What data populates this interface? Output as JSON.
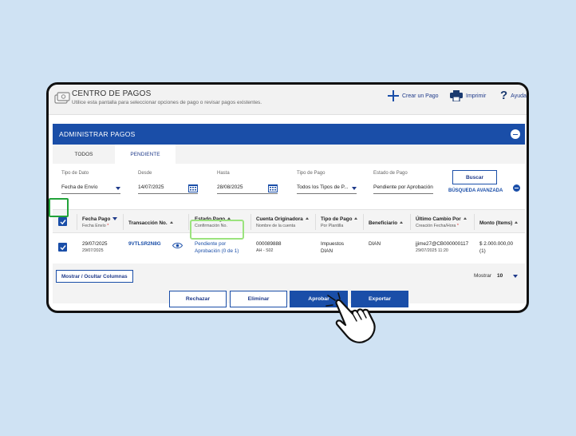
{
  "app": {
    "title": "CENTRO DE PAGOS",
    "subtitle": "Utilice esta pantalla para seleccionar opciones de pago o revisar pagos existentes.",
    "icon": "payment-cards-icon"
  },
  "top_actions": {
    "create": {
      "label": "Crear un Pago",
      "icon": "plus-icon"
    },
    "print": {
      "label": "Imprimir",
      "icon": "printer-icon"
    },
    "help": {
      "label": "Ayuda",
      "icon": "question-icon"
    }
  },
  "panel": {
    "title": "ADMINISTRAR PAGOS",
    "tabs": [
      {
        "label": "TODOS",
        "active": false
      },
      {
        "label": "PENDIENTE",
        "active": true
      }
    ]
  },
  "filters": {
    "date_type": {
      "label": "Tipo de Dato",
      "value": "Fecha de Envío"
    },
    "from": {
      "label": "Desde",
      "value": "14/07/2025"
    },
    "to": {
      "label": "Hasta",
      "value": "28/08/2025"
    },
    "payment_type": {
      "label": "Tipo de Pago",
      "value": "Todos los Tipos de P..."
    },
    "payment_status": {
      "label": "Estado de Pago",
      "value": "Pendiente por Aprobación"
    },
    "search_button": "Buscar",
    "advanced_search": "BÚSQUEDA AVANZADA"
  },
  "table": {
    "columns": [
      {
        "title": "Fecha Pago",
        "sub": "Fecha Envío",
        "sub_required": true
      },
      {
        "title": "Transacción No.",
        "sub": ""
      },
      {
        "title": "Estado Pago",
        "sub": "Confirmación No."
      },
      {
        "title": "Cuenta Originadora",
        "sub": "Nombre de la cuenta"
      },
      {
        "title": "Tipo de Pago",
        "sub": "Por Plantilla"
      },
      {
        "title": "Beneficiario",
        "sub": ""
      },
      {
        "title": "Último Cambio Por",
        "sub": "Creación Fecha/Hora",
        "sub_required": true
      },
      {
        "title": "Monto (Items)",
        "sub": ""
      }
    ],
    "rows": [
      {
        "selected": true,
        "fecha_pago": "29/07/2025",
        "fecha_envio": "29/07/2025",
        "transaccion": "9VTLSR2N8G",
        "estado_line1": "Pendiente por",
        "estado_line2": "Aprobación (0 de 1)",
        "cuenta": "000089888",
        "cuenta_nombre": "AH - S02",
        "tipo_line1": "Impuestos",
        "tipo_line2": "DIAN",
        "beneficiario": "DIAN",
        "ultimo_cambio": "jjime27@CB000000117",
        "creacion": "29/07/2025 11:20",
        "monto": "$ 2.000.000,00",
        "items": "(1)"
      }
    ]
  },
  "footer": {
    "columns_button": "Mostrar / Ocultar Columnas",
    "show_label": "Mostrar",
    "show_value": "10"
  },
  "actions": {
    "reject": "Rechazar",
    "delete": "Eliminar",
    "approve": "Aprobar",
    "export": "Exportar"
  },
  "colors": {
    "brand_blue": "#1a4ea8",
    "highlight_green": "#22a33a",
    "background": "#cfe2f3"
  }
}
